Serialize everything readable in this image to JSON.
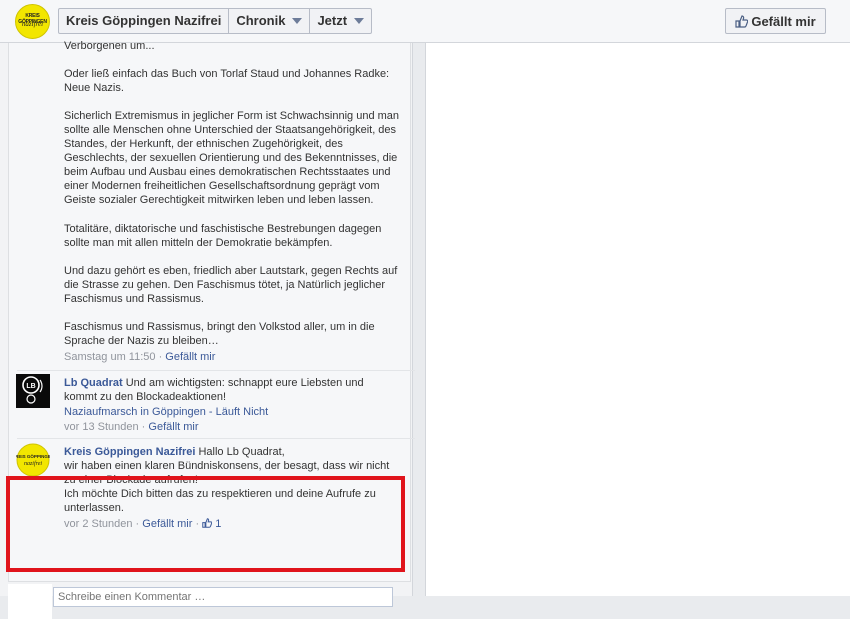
{
  "header": {
    "page_name": "Kreis Göppingen Nazifrei",
    "timeline_label": "Chronik",
    "date_label": "Jetzt",
    "like_button": "Gefällt mir",
    "logo_line1": "KREIS GÖPPINGEN",
    "logo_line2": "nazifrei"
  },
  "post": {
    "text_top": "Verborgenen um...",
    "paragraph1": "Oder ließ einfach das Buch von Torlaf Staud und Johannes Radke: Neue Nazis.",
    "paragraph2": "Sicherlich Extremismus in jeglicher Form ist Schwachsinnig und man sollte alle Menschen ohne Unterschied der Staatsangehörigkeit, des Standes, der Herkunft, der ethnischen Zugehörigkeit, des Geschlechts, der sexuellen Orientierung und des Bekenntnisses, die beim Aufbau und Ausbau eines demokratischen Rechtsstaates und einer Modernen freiheitlichen Gesellschaftsordnung geprägt vom Geiste sozialer Gerechtigkeit mitwirken leben und leben lassen.",
    "paragraph3": "Totalitäre, diktatorische und faschistische Bestrebungen dagegen sollte man mit allen mitteln der Demokratie bekämpfen.",
    "paragraph4": "Und dazu gehört es eben, friedlich aber Lautstark, gegen Rechts auf die Strasse zu gehen. Den Faschismus tötet, ja Natürlich jeglicher Faschismus und Rassismus.",
    "paragraph5": "Faschismus und Rassismus, bringt den Volkstod aller, um in die Sprache der Nazis zu bleiben…",
    "time": "Samstag um 11:50",
    "dot": " · ",
    "like": "Gefällt mir"
  },
  "comments": [
    {
      "author": "Lb Quadrat",
      "text": " Und am wichtigsten: schnappt eure Liebsten und kommt zu den Blockadeaktionen!",
      "link": "Naziaufmarsch in Göppingen - Läuft Nicht",
      "time": "vor 13 Stunden",
      "dot": " · ",
      "like": "Gefällt mir",
      "avatar_text": "LB"
    },
    {
      "author": "Kreis Göppingen Nazifrei",
      "text": " Hallo Lb Quadrat,",
      "text2": "wir haben einen klaren Bündniskonsens, der besagt, dass wir nicht zu einer Blockade aufrufen!",
      "text3": "Ich möchte Dich bitten das zu respektieren und deine Aufrufe zu unterlassen.",
      "time": "vor 2 Stunden",
      "dot": " · ",
      "like": "Gefällt mir",
      "dot2": " · ",
      "like_count": "1"
    }
  ],
  "composer": {
    "placeholder": "Schreibe einen Kommentar …"
  },
  "colors": {
    "highlight": "#e0141c",
    "link": "#3b5998",
    "logo_yellow": "#f2e600"
  }
}
